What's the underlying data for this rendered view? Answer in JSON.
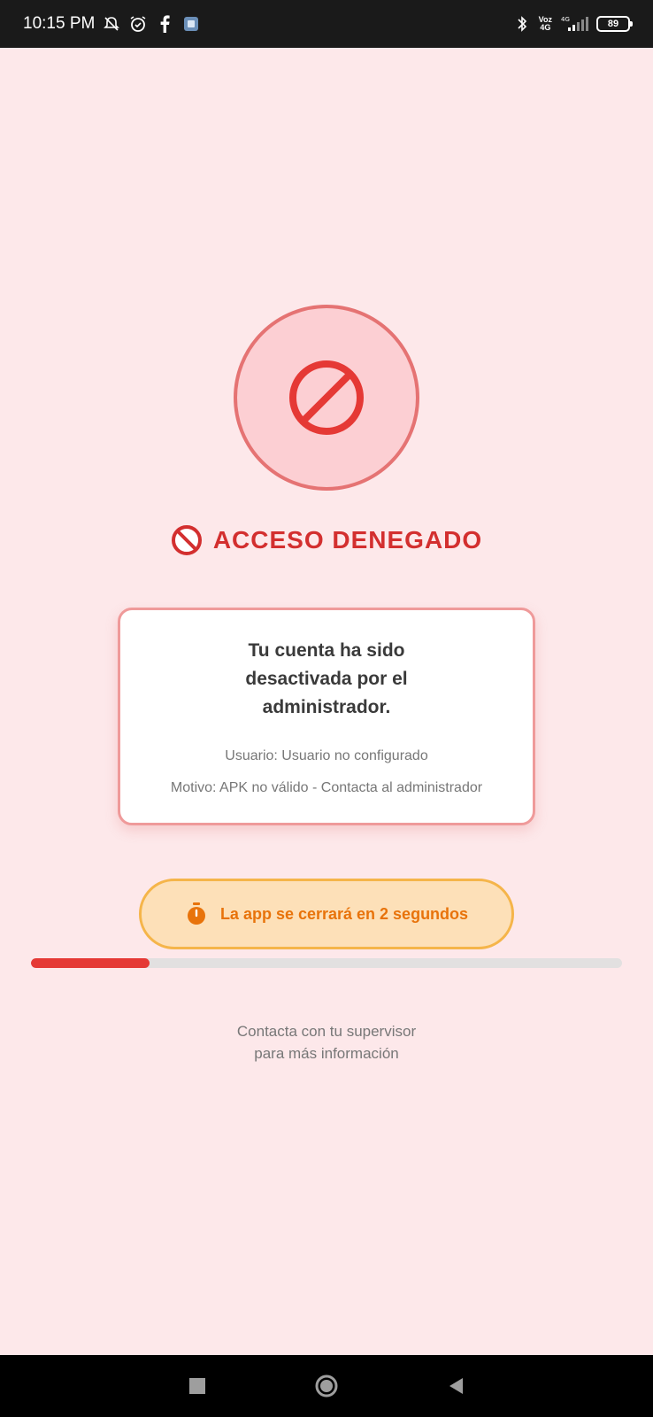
{
  "status_bar": {
    "time": "10:15 PM",
    "icons": [
      "mute-bell-icon",
      "alarm-icon",
      "facebook-icon",
      "app-notification-icon"
    ],
    "net_top": "Voz",
    "net_bottom": "4G",
    "signal_label": "4G",
    "battery": "89",
    "right_icons": [
      "bluetooth-icon",
      "signal-icon",
      "battery-icon"
    ]
  },
  "main": {
    "hero_icon": "block-icon",
    "title": "ACCESO DENEGADO",
    "title_icon": "no-entry-icon",
    "card": {
      "message": "Tu cuenta ha sido desactivada por el administrador.",
      "user_line": "Usuario: Usuario no configurado",
      "reason_line": "Motivo: APK no válido - Contacta al administrador"
    },
    "timer": {
      "icon": "stopwatch-icon",
      "text": "La app se cerrará en 2 segundos"
    },
    "progress_fraction": 0.2,
    "footer_line1": "Contacta con tu supervisor",
    "footer_line2": "para más información"
  },
  "nav_bar": {
    "buttons": [
      "recents-button",
      "home-button",
      "back-button"
    ]
  },
  "colors": {
    "background": "#fde8ea",
    "accent_red": "#d32f2f",
    "timer_orange": "#e8730b",
    "progress_red": "#e53935"
  }
}
